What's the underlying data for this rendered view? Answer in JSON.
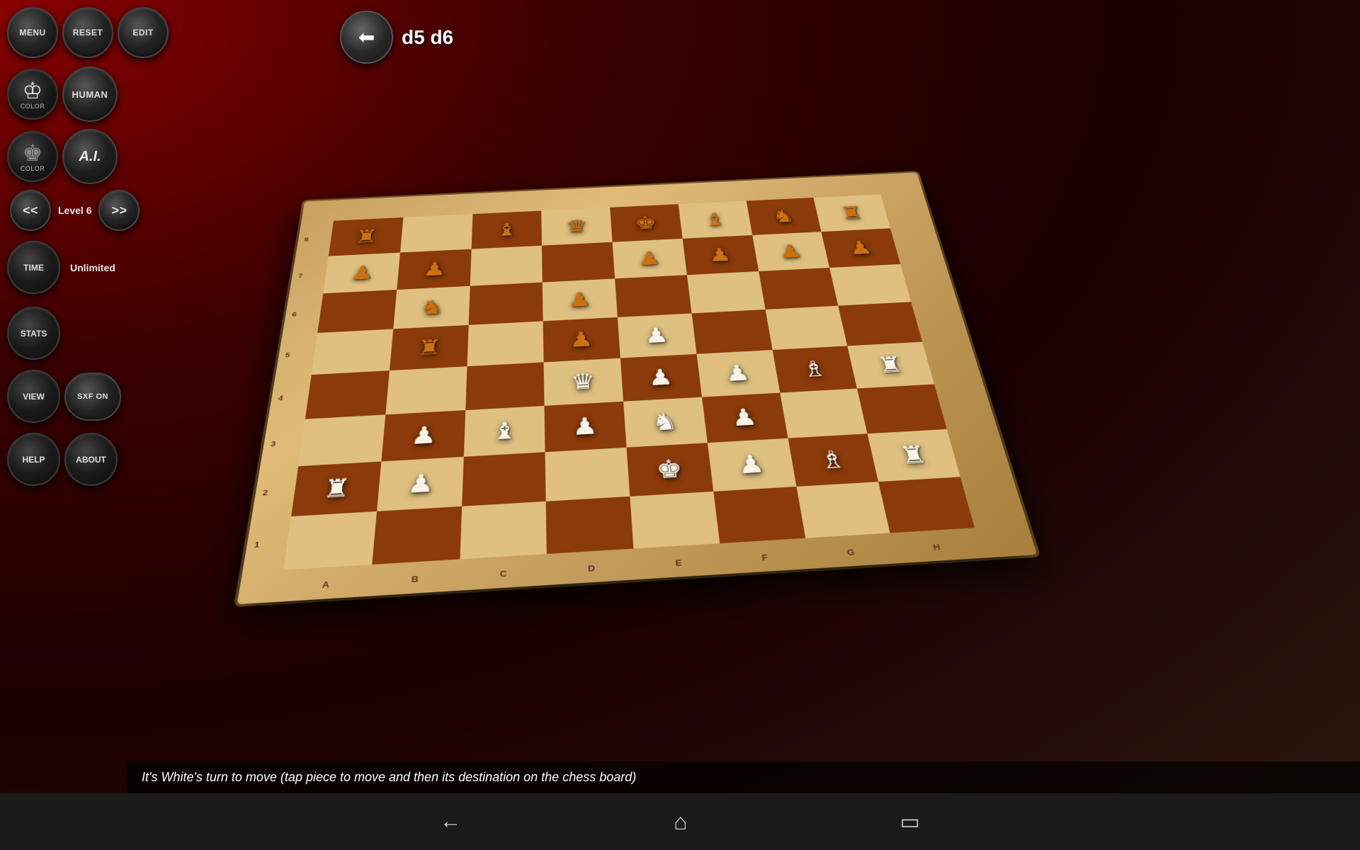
{
  "app": {
    "title": "Chess 3D"
  },
  "toolbar": {
    "menu_label": "MENU",
    "reset_label": "RESET",
    "edit_label": "EDIT"
  },
  "player1": {
    "color_label": "COLOR",
    "type_label": "HUMAN"
  },
  "player2": {
    "color_label": "COLOR",
    "ai_label": "A.I.",
    "prev_label": "<<",
    "level_label": "Level 6",
    "next_label": ">>"
  },
  "time": {
    "label": "TIME",
    "value": "Unlimited"
  },
  "stats_label": "STATS",
  "view_label": "VIEW",
  "sxf_label": "SXF ON",
  "help_label": "HELP",
  "about_label": "ABOUT",
  "move": {
    "last_move": "d5 d6",
    "back_arrow": "←"
  },
  "status": {
    "message": "It's White's turn to move (tap piece to move and then its destination on the chess board)"
  },
  "nav": {
    "back_icon": "←",
    "home_icon": "⌂",
    "recent_icon": "▭"
  },
  "board": {
    "ranks": [
      "8",
      "7",
      "6",
      "5",
      "4",
      "3",
      "2",
      "1"
    ],
    "files": [
      "A",
      "B",
      "C",
      "D",
      "E",
      "F",
      "G",
      "H"
    ]
  }
}
